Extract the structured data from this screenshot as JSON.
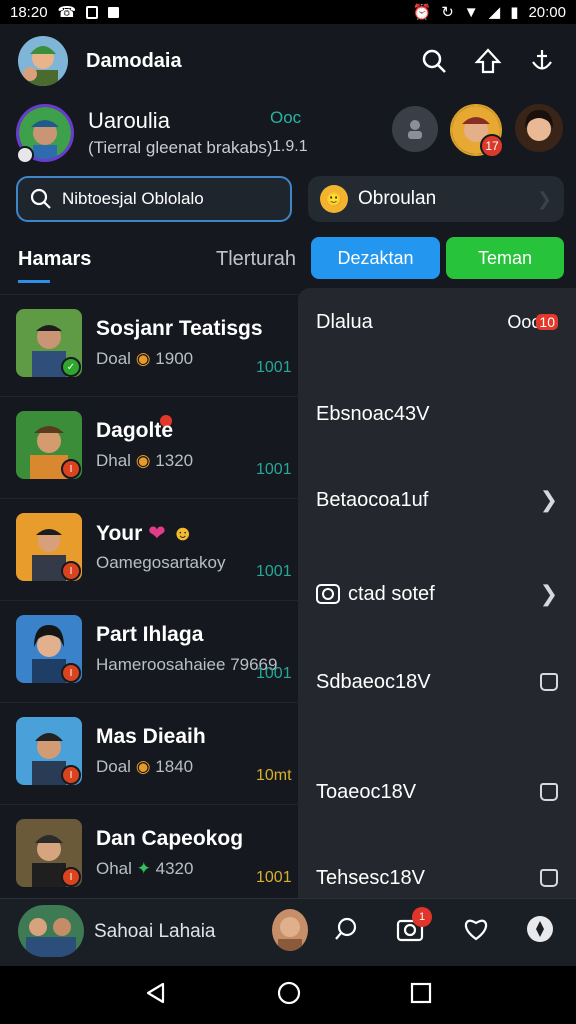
{
  "status_bar": {
    "time": "18:20",
    "battery_time": "20:00"
  },
  "header": {
    "title": "Damodaia"
  },
  "profile": {
    "name": "Uaroulia",
    "subtitle": "(Tierral gleenat brakabs)",
    "code": "Ooc",
    "number": "1.9.1",
    "friend_badge": "17"
  },
  "search": {
    "placeholder": "Nibtoesjal Oblolalo"
  },
  "group_chip": {
    "emoji": "🙂",
    "label": "Obroulan"
  },
  "tabs": [
    {
      "label": "Hamars"
    },
    {
      "label": "Tlerturah"
    }
  ],
  "actions": {
    "blue_button": "Dezaktan",
    "green_button": "Teman"
  },
  "chats": [
    {
      "name": "Sosjanr Teatisgs",
      "preview": "Doal",
      "amount": "1900",
      "time": "1001",
      "badge": "✓"
    },
    {
      "name": "Dagolte",
      "preview": "Dhal",
      "amount": "1320",
      "time": "1001",
      "badge": "I"
    },
    {
      "name": "Your",
      "preview": "Oamegosartakoy",
      "amount": "",
      "time": "1001",
      "badge": "I"
    },
    {
      "name": "Part Ihlaga",
      "preview": "Hameroosahaiee 79669",
      "amount": "",
      "time": "1001",
      "badge": "I"
    },
    {
      "name": "Mas Dieaih",
      "preview": "Doal",
      "amount": "1840",
      "time": "10mt",
      "badge": "I"
    },
    {
      "name": "Dan Capeokog",
      "preview": "Ohal",
      "amount": "4320",
      "time": "1001",
      "badge": "I"
    }
  ],
  "panel": {
    "header_label": "Dlalua",
    "header_count": "Ooc",
    "header_badge": "10",
    "rows": [
      {
        "label": "Ebsnoac43V"
      },
      {
        "label": "Betaocoa1uf"
      },
      {
        "label": "ctad sotef"
      },
      {
        "label": "Sdbaeoc18V"
      },
      {
        "label": "Toaeoc18V"
      },
      {
        "label": "Tehsesc18V"
      }
    ]
  },
  "bottom_bar": {
    "label": "Sahoai Lahaia",
    "badge": "1"
  }
}
